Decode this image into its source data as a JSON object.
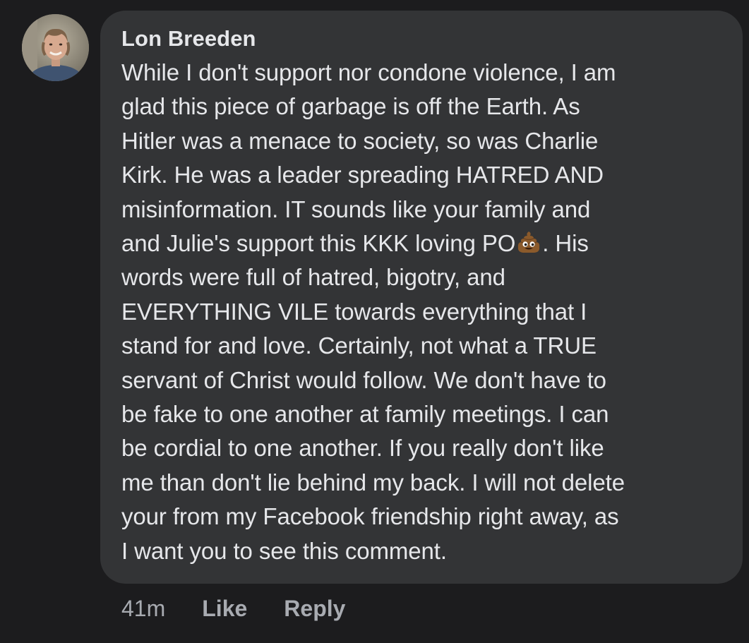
{
  "comment": {
    "author": "Lon Breeden",
    "avatar_icon": "profile-photo",
    "lines": [
      "While I don't support nor condone violence, I am",
      "glad this piece of garbage is off the Earth. As",
      "Hitler was a menace to society, so was Charlie",
      "Kirk. He was a leader spreading HATRED AND",
      "misinformation. IT sounds like your family and",
      "and Julie's support this KKK loving PO",
      "words were full of hatred, bigotry, and",
      "EVERYTHING VILE towards everything that I",
      "stand for and love. Certainly, not what a TRUE",
      "servant of Christ would follow. We don't have to",
      "be fake to one another at family meetings. I can",
      "be cordial to one another. If you really don't like",
      "me than don't lie behind my back. I will not delete",
      "your from my Facebook friendship right away, as",
      "I want you to see this comment."
    ],
    "line6_after_emoji": ". His",
    "emoji_icon": "pile-of-poo-emoji"
  },
  "actions": {
    "timestamp": "41m",
    "like_label": "Like",
    "reply_label": "Reply"
  },
  "colors": {
    "background": "#1c1c1e",
    "bubble": "#333436",
    "text": "#e6e7ea",
    "secondary_text": "#a8abb1"
  }
}
